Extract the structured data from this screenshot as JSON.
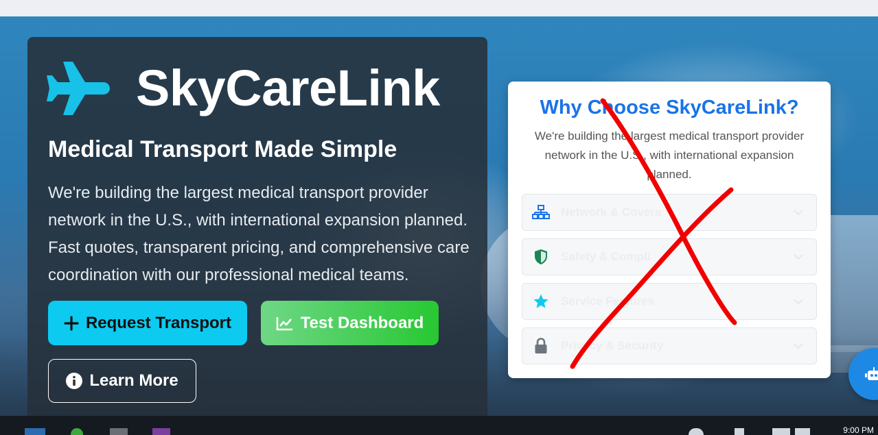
{
  "brand": {
    "name": "SkyCareLink",
    "logo_icon": "plane-icon",
    "tagline": "Medical Transport Made Simple",
    "description": "We're building the largest medical transport provider network in the U.S., with international expansion planned. Fast quotes, transparent pricing, and comprehensive care coordination with our professional medical teams."
  },
  "actions": {
    "request_label": "Request Transport",
    "request_icon": "plus-icon",
    "test_label": "Test Dashboard",
    "test_icon": "chart-line-icon",
    "learn_label": "Learn More",
    "learn_icon": "info-circle-icon"
  },
  "why_card": {
    "title": "Why Choose SkyCareLink?",
    "subtitle": "We're building the largest medical transport provider network in the U.S., with international expansion planned.",
    "items": [
      {
        "label": "Network & Covera",
        "icon": "network-icon",
        "icon_color": "#1a73e8"
      },
      {
        "label": "Safety & Compli",
        "icon": "shield-icon",
        "icon_color": "#198754"
      },
      {
        "label": "Service Features",
        "icon": "star-icon",
        "icon_color": "#0dcaf0"
      },
      {
        "label": "Privacy & Security",
        "icon": "lock-icon",
        "icon_color": "#6c757d"
      }
    ]
  },
  "annotation": {
    "mark": "red-x",
    "color": "#ff0000"
  },
  "chat_button": {
    "icon": "robot-icon"
  },
  "taskbar": {
    "clock": "9:00 PM"
  },
  "colors": {
    "accent_blue": "#1a73e8",
    "request_bg": "#0dcaf0",
    "test_bg": "#28c832",
    "logo_cyan": "#17c1e8"
  }
}
